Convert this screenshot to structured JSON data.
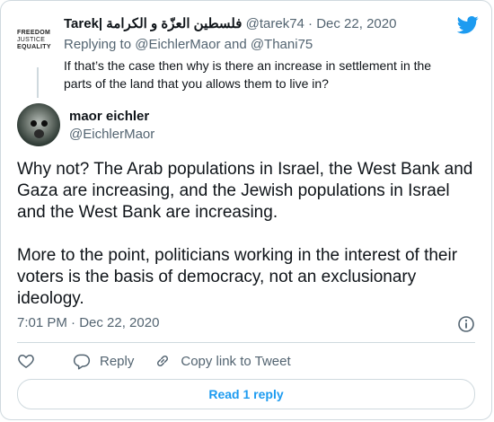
{
  "parent_tweet": {
    "avatar_lines": [
      "FREEDOM",
      "JUSTICE",
      "EQUALITY"
    ],
    "display_name": "Tarek| فلسطين العزّة و الكرامة",
    "handle_and_date": "@tarek74 · Dec 22, 2020",
    "replying_to": "Replying to @EichlerMaor and @Thani75",
    "text": "If that’s the case then why is there an increase in settlement in the parts of the land that you allows them to live in?"
  },
  "main_tweet": {
    "display_name": "maor eichler",
    "handle": "@EichlerMaor",
    "paragraphs": [
      "Why not? The Arab populations in Israel, the West Bank and Gaza are increasing, and the Jewish populations in Israel and the West Bank are increasing.",
      "More to the point, politicians working in the interest of their voters is the basis of democracy, not an exclusionary ideology."
    ],
    "timestamp": "7:01 PM · Dec 22, 2020"
  },
  "actions": {
    "reply_label": "Reply",
    "copy_link_label": "Copy link to Tweet"
  },
  "read_replies_label": "Read 1 reply",
  "colors": {
    "accent": "#1d9bf0",
    "secondary_text": "#536471",
    "border": "#cfd9de"
  },
  "icons": [
    "twitter-bird-icon",
    "info-icon",
    "heart-icon",
    "reply-bubble-icon",
    "link-icon"
  ]
}
